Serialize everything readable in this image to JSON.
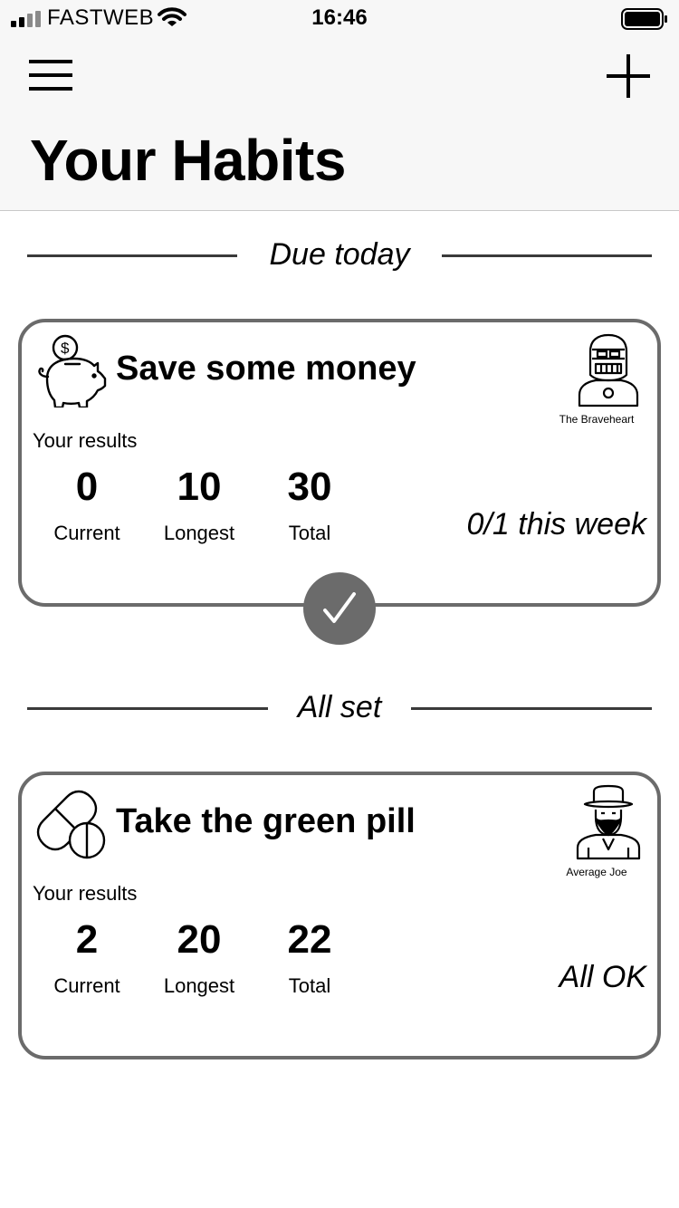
{
  "status_bar": {
    "carrier": "FASTWEB",
    "time": "16:46",
    "signal_icon": "signal-bars-icon",
    "wifi_icon": "wifi-icon",
    "battery_icon": "battery-icon"
  },
  "header": {
    "menu_icon": "hamburger-menu-icon",
    "add_icon": "plus-icon",
    "title": "Your Habits"
  },
  "sections": {
    "due_today": "Due today",
    "all_set": "All set"
  },
  "habits": [
    {
      "title": "Save some money",
      "icon": "piggy-bank-icon",
      "avatar_icon": "knight-helmet-icon",
      "avatar_name": "The Braveheart",
      "results_label": "Your results",
      "stats": [
        {
          "value": "0",
          "label": "Current"
        },
        {
          "value": "10",
          "label": "Longest"
        },
        {
          "value": "30",
          "label": "Total"
        }
      ],
      "status": "0/1 this week",
      "action_icon": "checkmark-icon"
    },
    {
      "title": "Take the green pill",
      "icon": "pill-icon",
      "avatar_icon": "bearded-man-hat-icon",
      "avatar_name": "Average Joe",
      "results_label": "Your results",
      "stats": [
        {
          "value": "2",
          "label": "Current"
        },
        {
          "value": "20",
          "label": "Longest"
        },
        {
          "value": "22",
          "label": "Total"
        }
      ],
      "status": "All OK"
    }
  ],
  "colors": {
    "header_bg": "#f7f7f7",
    "card_border": "#6b6b6b",
    "check_button": "#6b6b6b",
    "separator": "#3a3a3a"
  }
}
